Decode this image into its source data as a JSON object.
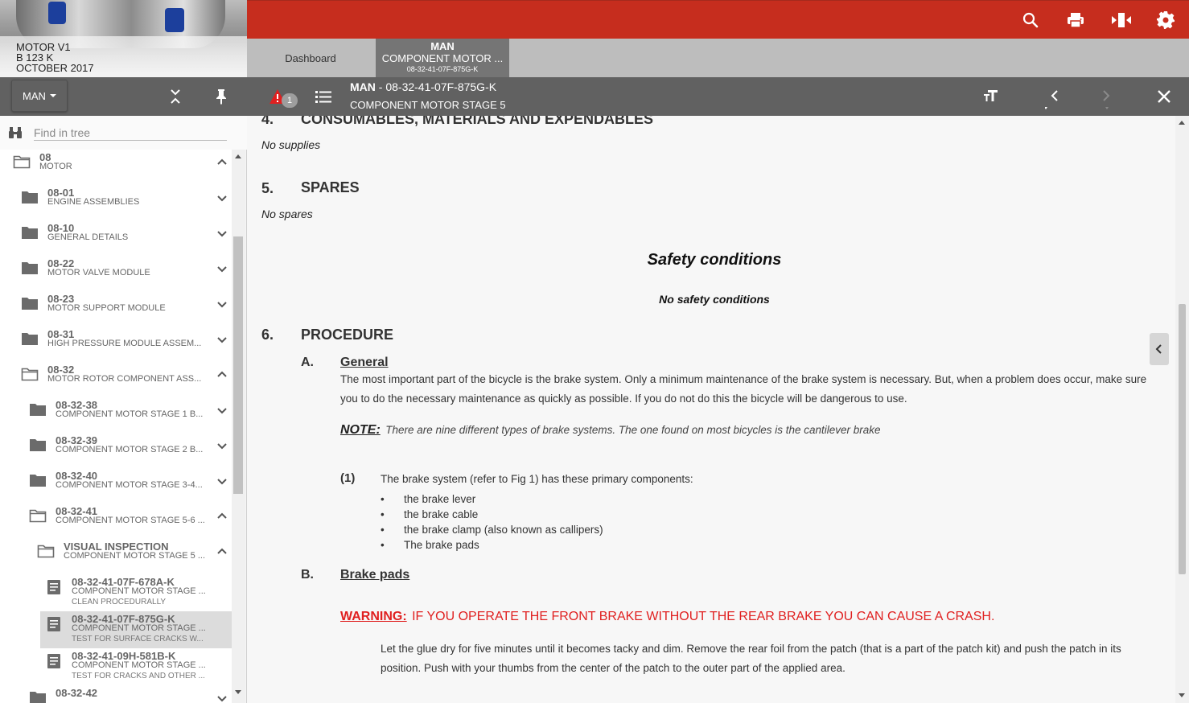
{
  "doc_header": {
    "line1": "MOTOR V1",
    "line2": "B 123 K",
    "line3": "OCTOBER 2017"
  },
  "tree_toolbar": {
    "man_label": "MAN"
  },
  "search": {
    "placeholder": "Find in tree"
  },
  "tree": [
    {
      "code": "08",
      "name": "MOTOR",
      "open": true,
      "icon": "folder-open-icon",
      "chevron": "up"
    },
    {
      "code": "08-01",
      "name": "ENGINE ASSEMBLIES",
      "icon": "folder-icon",
      "chevron": "down"
    },
    {
      "code": "08-10",
      "name": "GENERAL DETAILS",
      "icon": "folder-icon",
      "chevron": "down"
    },
    {
      "code": "08-22",
      "name": "MOTOR VALVE MODULE",
      "icon": "folder-icon",
      "chevron": "down"
    },
    {
      "code": "08-23",
      "name": "MOTOR SUPPORT MODULE",
      "icon": "folder-icon",
      "chevron": "down"
    },
    {
      "code": "08-31",
      "name": "HIGH PRESSURE MODULE ASSEM...",
      "icon": "folder-icon",
      "chevron": "down"
    },
    {
      "code": "08-32",
      "name": "MOTOR ROTOR COMPONENT ASS...",
      "icon": "folder-open-icon",
      "chevron": "up"
    },
    {
      "code": "08-32-38",
      "name": "COMPONENT MOTOR STAGE 1 B...",
      "icon": "folder-icon",
      "chevron": "down"
    },
    {
      "code": "08-32-39",
      "name": "COMPONENT MOTOR STAGE 2 B...",
      "icon": "folder-icon",
      "chevron": "down"
    },
    {
      "code": "08-32-40",
      "name": "COMPONENT MOTOR STAGE 3-4...",
      "icon": "folder-icon",
      "chevron": "down"
    },
    {
      "code": "08-32-41",
      "name": "COMPONENT MOTOR STAGE 5-6 ...",
      "icon": "folder-open-icon",
      "chevron": "up"
    },
    {
      "code": "VISUAL INSPECTION",
      "name": "COMPONENT MOTOR STAGE 5 ...",
      "icon": "folder-open-icon",
      "chevron": "up"
    },
    {
      "code": "08-32-41-07F-678A-K",
      "name": "COMPONENT MOTOR STAGE ...",
      "sub": "CLEAN PROCEDURALLY",
      "icon": "document-icon"
    },
    {
      "code": "08-32-41-07F-875G-K",
      "name": "COMPONENT MOTOR STAGE ...",
      "sub": "TEST FOR SURFACE CRACKS W...",
      "icon": "document-icon",
      "selected": true
    },
    {
      "code": "08-32-41-09H-581B-K",
      "name": "COMPONENT MOTOR STAGE ...",
      "sub": "TEST FOR CRACKS AND OTHER ...",
      "icon": "document-icon"
    },
    {
      "code": "08-32-42",
      "name": "",
      "icon": "folder-icon",
      "chevron": "down"
    }
  ],
  "tabs": {
    "dashboard": "Dashboard",
    "doc_l1": "MAN",
    "doc_l2": "COMPONENT MOTOR ...",
    "doc_l3": "08-32-41-07F-875G-K"
  },
  "docbar": {
    "warning_count": "1",
    "prefix": "MAN",
    "code": " - 08-32-41-07F-875G-K",
    "title": "COMPONENT MOTOR STAGE 5"
  },
  "content": {
    "s4_num": "4.",
    "s4_title": "CONSUMABLES, MATERIALS AND EXPENDABLES",
    "s4_text": "No supplies",
    "s5_num": "5.",
    "s5_title": "SPARES",
    "s5_text": "No spares",
    "safety_title": "Safety conditions",
    "safety_text": "No safety conditions",
    "s6_num": "6.",
    "s6_title": "PROCEDURE",
    "a_letter": "A.",
    "a_title": "General",
    "a_text": "The most important part of the bicycle is the brake system. Only a minimum maintenance of the brake system is necessary. But, when a problem does occur, make sure you to do the necessary maintenance as quickly as possible. If you do not do this the bicycle will be dangerous to use.",
    "note_label": "NOTE:",
    "note_text": "There are nine different types of brake systems. The one found on most bicycles is the cantilever brake",
    "step1_num": "(1)",
    "step1_text": "The brake system (refer to Fig 1) has these primary components:",
    "bullets": [
      "the brake lever",
      "the brake cable",
      "the brake clamp (also known as callipers)",
      "The brake pads"
    ],
    "b_letter": "B.",
    "b_title": "Brake pads",
    "warning_label": "WARNING:",
    "warning_text": "IF YOU OPERATE THE FRONT BRAKE WITHOUT THE REAR BRAKE YOU CAN CAUSE A CRASH.",
    "b_text": "Let the glue dry for five minutes until it becomes tacky and dim. Remove the rear foil from the patch (that is a part of the patch kit) and push the patch in its position. Push with your thumbs from the center of the patch to the outer part of the applied area."
  },
  "colors": {
    "brand_red": "#c62d1e",
    "warning_red": "#e02020"
  }
}
